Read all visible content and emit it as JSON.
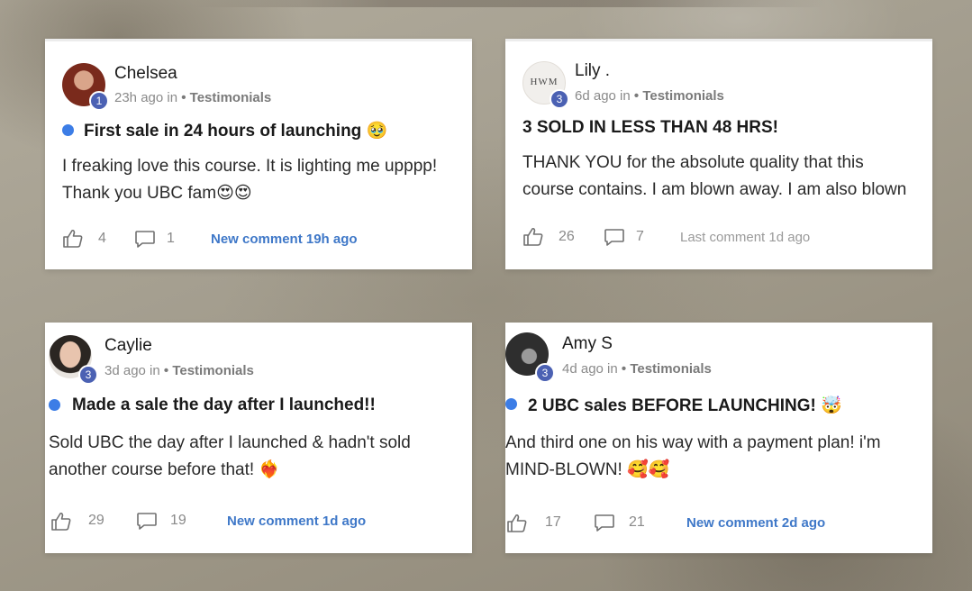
{
  "posts": [
    {
      "author": "Chelsea",
      "level": "1",
      "time": "23h ago in",
      "category": "• Testimonials",
      "title": "First sale in 24 hours of launching 🥹",
      "body": "I freaking love this course. It is lighting me upppp!\nThank you UBC fam😍😍",
      "likes": "4",
      "comments": "1",
      "activity": "New comment 19h ago",
      "avatar_color": "#7a2a1c"
    },
    {
      "author": "Lily .",
      "level": "3",
      "time": "6d ago in",
      "category": "• Testimonials",
      "title": "3 SOLD IN LESS THAN 48 HRS!",
      "body": "THANK YOU for the absolute quality that this\ncourse contains. I am blown away. I am also blown",
      "likes": "26",
      "comments": "7",
      "activity": "Last comment 1d ago",
      "avatar_text": "HWM",
      "avatar_color": "#f1efec"
    },
    {
      "author": "Caylie",
      "level": "3",
      "time": "3d ago in",
      "category": "• Testimonials",
      "title": "Made a sale the day after I launched!!",
      "body": "Sold UBC the day after I launched & hadn't sold\nanother course before that! ❤️‍🔥",
      "likes": "29",
      "comments": "19",
      "activity": "New comment 1d ago",
      "avatar_color": "#2b2622"
    },
    {
      "author": "Amy S",
      "level": "3",
      "time": "4d ago in",
      "category": "• Testimonials",
      "title": "2 UBC sales BEFORE LAUNCHING! 🤯",
      "body": "And third one on his way with a payment plan! i'm\nMIND-BLOWN! 🥰🥰",
      "likes": "17",
      "comments": "21",
      "activity": "New comment 2d ago",
      "avatar_color": "#2e2e2e"
    }
  ],
  "colors": {
    "accent_blue": "#3f78c8",
    "unread_dot": "#3c7de6",
    "level_badge": "#4b61b3"
  }
}
